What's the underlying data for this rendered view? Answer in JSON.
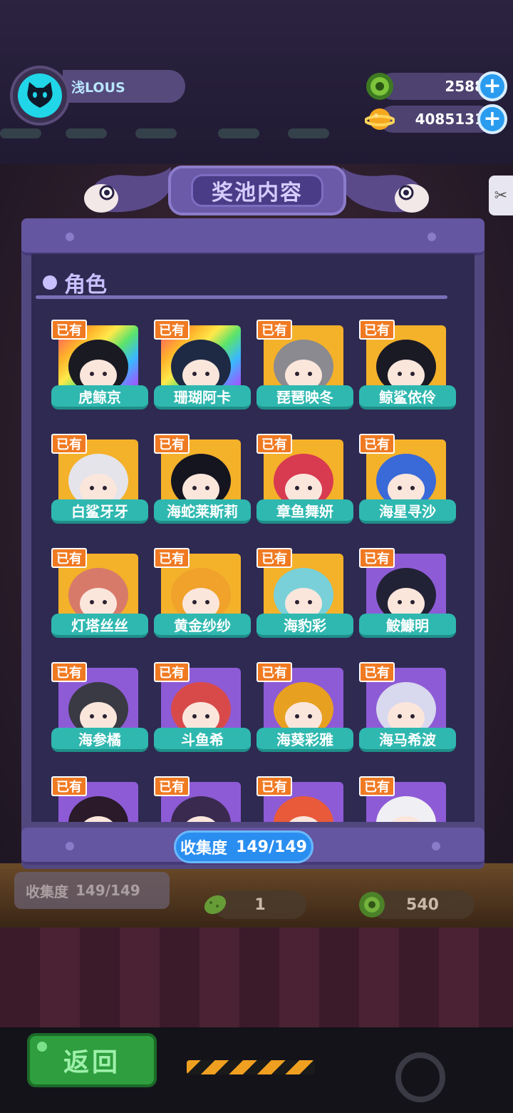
{
  "player": {
    "name": "浅LOUS",
    "avatar_icon": "cat-face-icon"
  },
  "currencies": [
    {
      "icon": "green-coin-icon",
      "value": "2588"
    },
    {
      "icon": "gold-planet-coin-icon",
      "value": "4085131"
    }
  ],
  "title": "奖池内容",
  "section": {
    "label": "角色"
  },
  "owned_badge": "已有",
  "characters": [
    {
      "name": "虎鲸京",
      "bg": "rainbow",
      "hair": "#1a1a22"
    },
    {
      "name": "珊瑚阿卡",
      "bg": "rainbow",
      "hair": "#1e2a44"
    },
    {
      "name": "琵琶映冬",
      "bg": "gold",
      "hair": "#8a8a90"
    },
    {
      "name": "鲸鲨依伶",
      "bg": "gold",
      "hair": "#1a1a24"
    },
    {
      "name": "白鲨牙牙",
      "bg": "gold",
      "hair": "#e4e4ea"
    },
    {
      "name": "海蛇莱斯莉",
      "bg": "gold",
      "hair": "#151520"
    },
    {
      "name": "章鱼舞妍",
      "bg": "gold",
      "hair": "#d83a50"
    },
    {
      "name": "海星寻沙",
      "bg": "gold",
      "hair": "#3a6ad8"
    },
    {
      "name": "灯塔丝丝",
      "bg": "gold",
      "hair": "#d87a6a"
    },
    {
      "name": "黄金纱纱",
      "bg": "gold",
      "hair": "#f0a22a"
    },
    {
      "name": "海豹彩",
      "bg": "gold",
      "hair": "#7ad0d8"
    },
    {
      "name": "鮟鱇明",
      "bg": "purple",
      "hair": "#222236"
    },
    {
      "name": "海参橘",
      "bg": "purple",
      "hair": "#3a3a44"
    },
    {
      "name": "斗鱼希",
      "bg": "purple",
      "hair": "#d84a4a"
    },
    {
      "name": "海葵彩雅",
      "bg": "purple",
      "hair": "#e8a020"
    },
    {
      "name": "海马希波",
      "bg": "purple",
      "hair": "#d8d8ee"
    },
    {
      "name": "",
      "bg": "purple",
      "hair": "#2a1a2a"
    },
    {
      "name": "",
      "bg": "purple",
      "hair": "#3a2a50"
    },
    {
      "name": "",
      "bg": "purple",
      "hair": "#e85a3a"
    },
    {
      "name": "",
      "bg": "purple",
      "hair": "#f0f0f4"
    }
  ],
  "collection": {
    "label": "收集度",
    "value": "149/149"
  },
  "background_ui": {
    "collection_label": "收集度",
    "collection_value": "149/149",
    "price1": "1",
    "price2": "540"
  },
  "back_button": "返回",
  "colors": {
    "owned_badge": "#f07a22",
    "name_plate": "#2fb8b0",
    "collect_pill": "#2a8ef0",
    "panel": "#2e2a52"
  }
}
